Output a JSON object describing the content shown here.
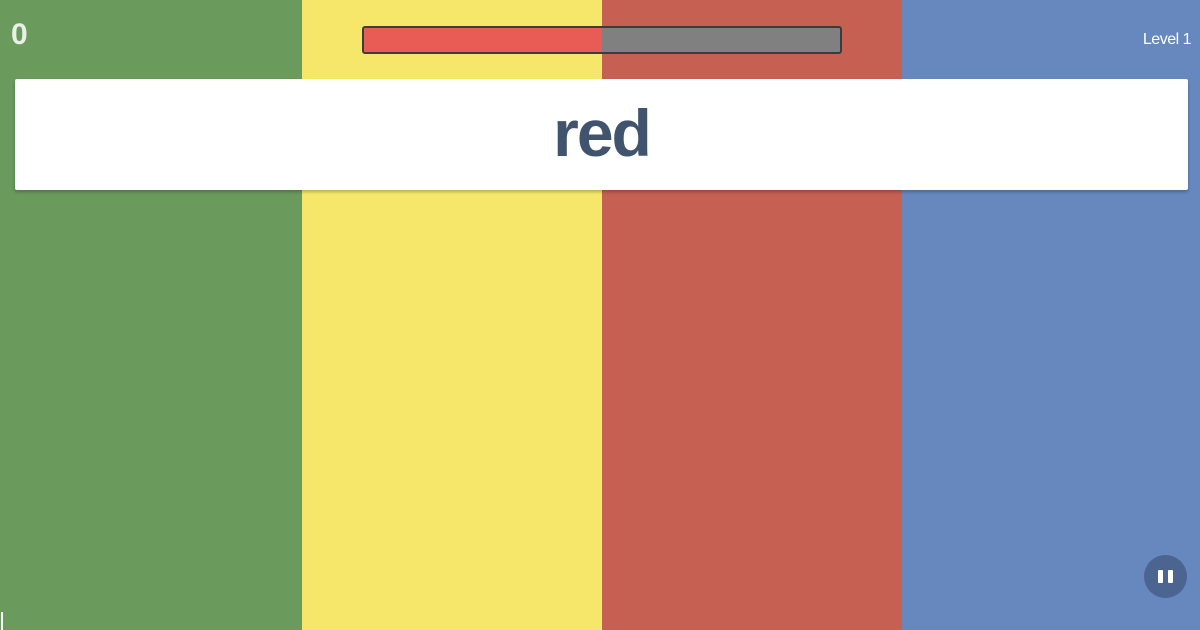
{
  "score": "0",
  "level_label": "Level 1",
  "timer": {
    "remaining_fraction": 0.5,
    "fill_color": "#e85c55",
    "track_color": "#808080"
  },
  "word": "red",
  "columns": [
    {
      "name": "green",
      "color": "#6a9a5c"
    },
    {
      "name": "yellow",
      "color": "#f6e76a"
    },
    {
      "name": "red",
      "color": "#c56053"
    },
    {
      "name": "blue",
      "color": "#6688be"
    }
  ],
  "pause_button": {
    "icon": "pause-icon",
    "color": "#4b6490"
  }
}
